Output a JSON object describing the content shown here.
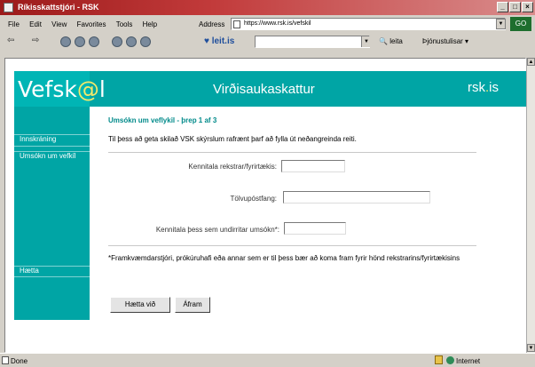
{
  "window": {
    "title": "Ríkisskattstjóri - RSK",
    "buttons": [
      "_",
      "□",
      "×"
    ]
  },
  "menu": [
    "File",
    "Edit",
    "View",
    "Favorites",
    "Tools",
    "Help"
  ],
  "address": {
    "label": "Address",
    "url": "https://www.rsk.is/vefskil"
  },
  "go_label": "GO",
  "leit_toolbar": {
    "logo": "♥ leit.is",
    "search_button": "leita",
    "service_button": "Þjónustulisar"
  },
  "banner": {
    "logo_left": "Vefsk",
    "logo_accent": "@",
    "logo_right": "l",
    "title": "Virðisaukaskattur",
    "rsk_left": "rsk",
    "rsk_dot": ".",
    "rsk_right": "is"
  },
  "sidebar": {
    "items": [
      "Innskráning",
      "Umsókn um vefkíl",
      "Hætta"
    ]
  },
  "form": {
    "heading": "Umsókn um veflykil - þrep 1 af 3",
    "intro": "Til þess að geta skilað VSK skýrslum rafrænt þarf að fylla út neðangreinda reiti.",
    "fields": [
      {
        "label": "Kennitala rekstrar/fyrirtækis:"
      },
      {
        "label": "Tölvupóstfang:"
      },
      {
        "label": "Kennitala þess sem undirritar umsókn*:"
      }
    ],
    "footnote": "*Framkvæmdarstjóri, prókúruhafi eða annar sem er til þess bær að koma fram fyrir hönd rekstrarins/fyrirtækisins",
    "cancel_label": "Hætta við",
    "next_label": "Áfram"
  },
  "status": {
    "text": "Done",
    "zone": "Internet"
  }
}
